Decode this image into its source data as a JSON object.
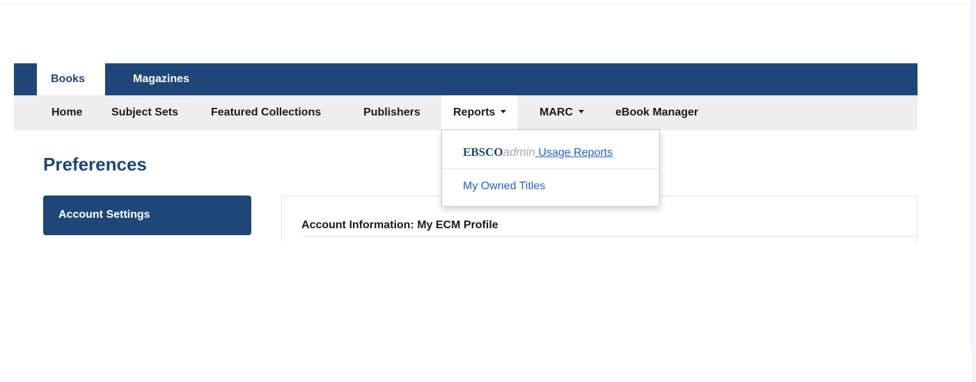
{
  "topnav": {
    "tabs": [
      {
        "label": "Books",
        "active": true
      },
      {
        "label": "Magazines",
        "active": false
      }
    ]
  },
  "subnav": {
    "items": [
      {
        "label": "Home"
      },
      {
        "label": "Subject Sets"
      },
      {
        "label": "Featured Collections"
      },
      {
        "label": "Publishers"
      },
      {
        "label": "Reports"
      },
      {
        "label": "MARC"
      },
      {
        "label": "eBook Manager"
      }
    ]
  },
  "reports_dropdown": {
    "brand_main": "EBSCO",
    "brand_sub": "admin",
    "usage_label": " Usage Reports",
    "owned_label": "My Owned Titles"
  },
  "page": {
    "title": "Preferences",
    "account_settings": "Account Settings",
    "panel_heading": "Account Information: My ECM Profile"
  },
  "colors": {
    "brand_navy": "#1f4678",
    "link_blue": "#1e63c4",
    "subnav_gray": "#eeeeee"
  }
}
